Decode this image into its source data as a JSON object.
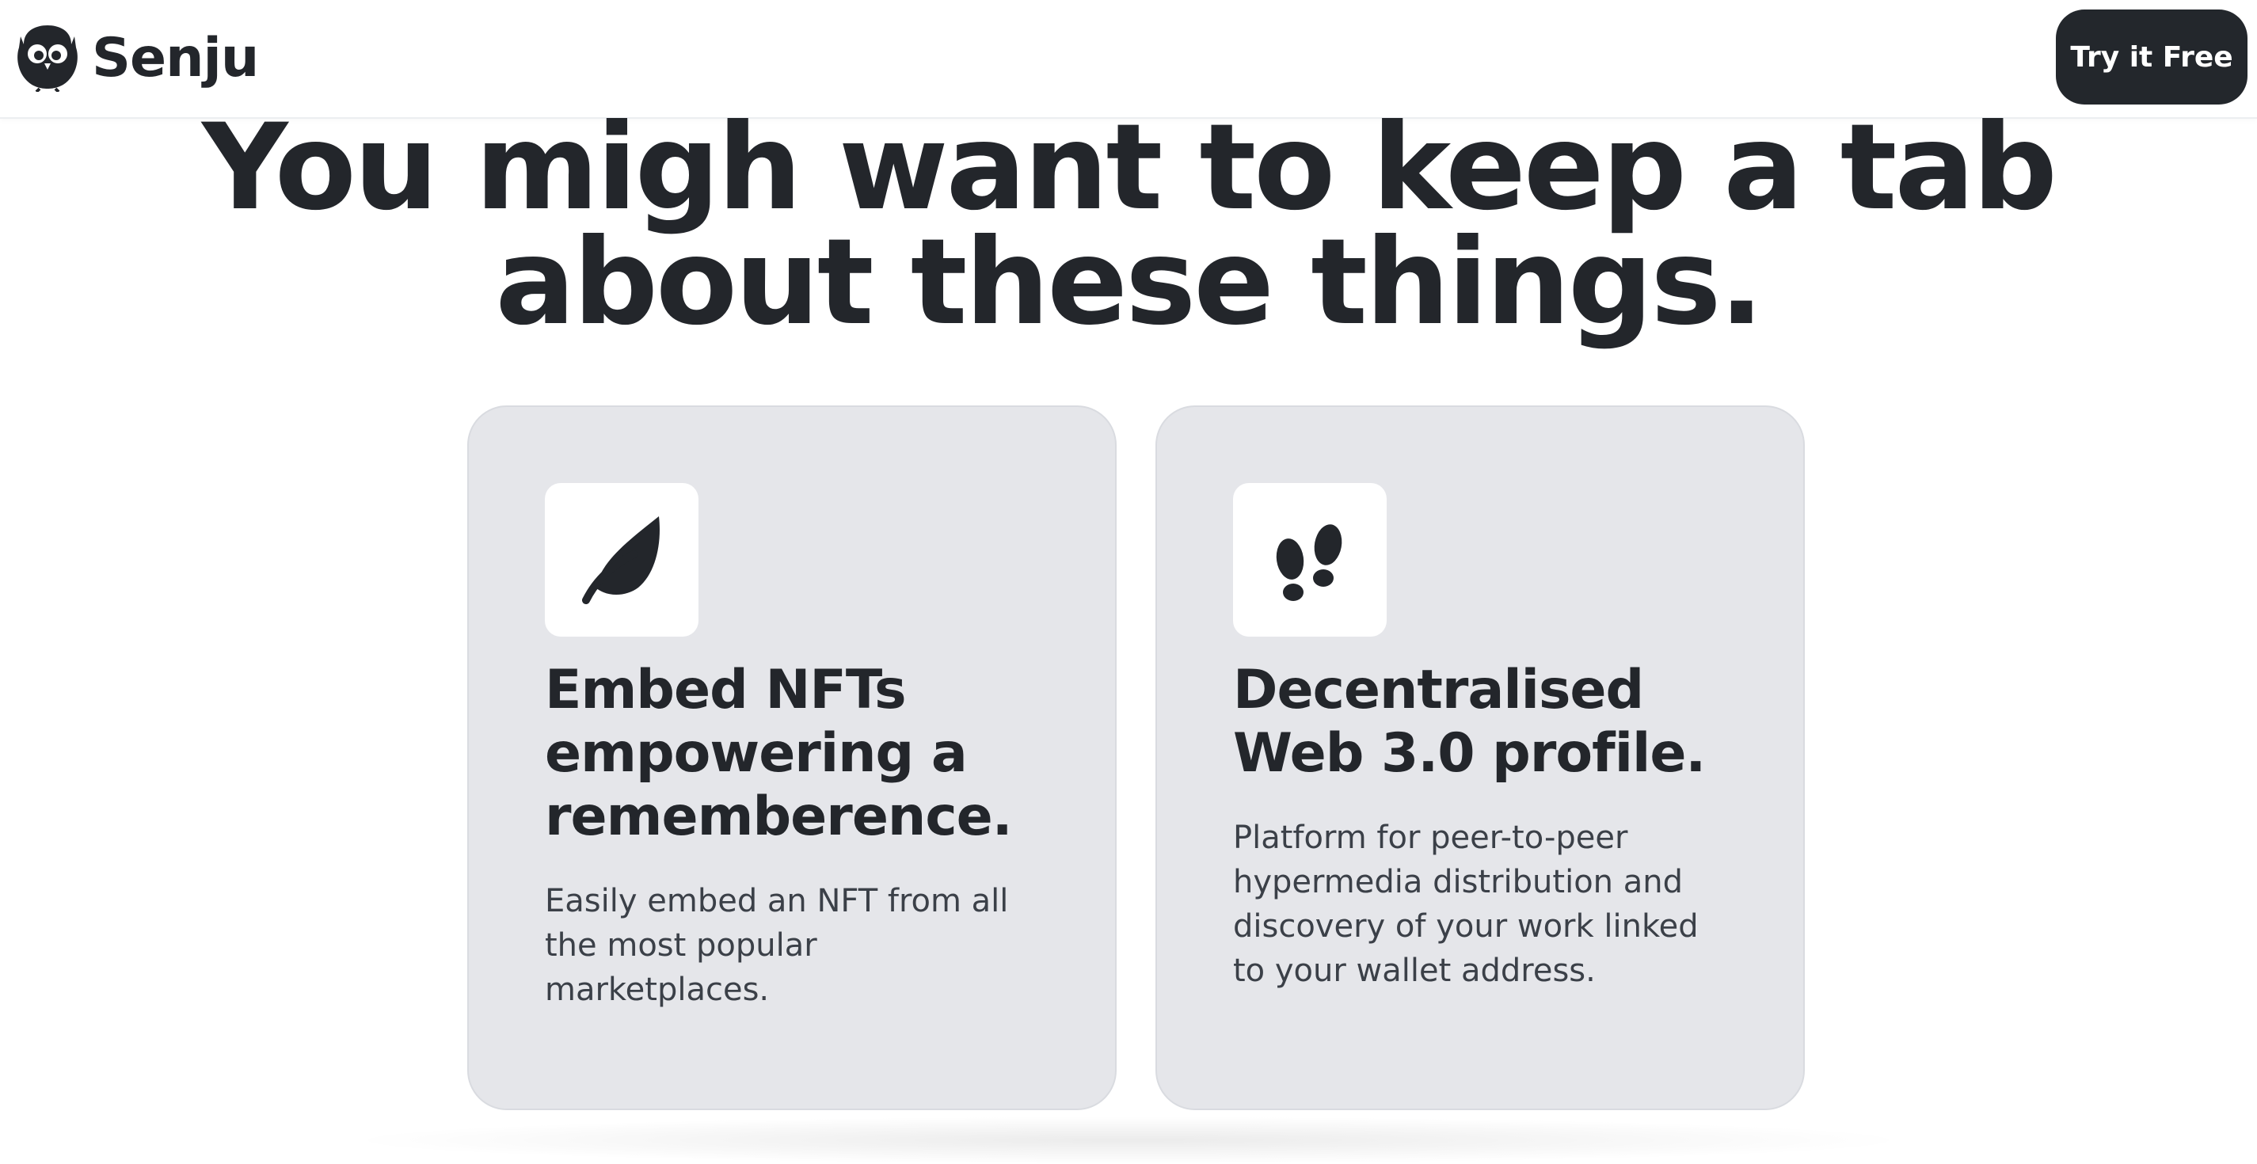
{
  "header": {
    "brand": "Senju",
    "logo_icon": "owl-icon",
    "cta_label": "Try it Free"
  },
  "hero": {
    "headline_line1": "You migh want to keep a tab",
    "headline_line2": "about these things."
  },
  "features": [
    {
      "icon": "leaf-icon",
      "title_lines": [
        "Embed NFTs",
        "empowering a",
        "rememberence."
      ],
      "desc_lines": [
        "Easily embed an NFT from all",
        "the most popular",
        "marketplaces."
      ]
    },
    {
      "icon": "footprints-icon",
      "title_lines": [
        "Decentralised",
        "Web 3.0 profile."
      ],
      "desc_lines": [
        "Platform for peer-to-peer",
        "hypermedia distribution and",
        "discovery of your work linked",
        "to your wallet address."
      ]
    }
  ],
  "colors": {
    "text": "#23262b",
    "card_bg": "#e5e6ea",
    "cta_bg": "#23272c",
    "page_bg": "#ffffff"
  }
}
